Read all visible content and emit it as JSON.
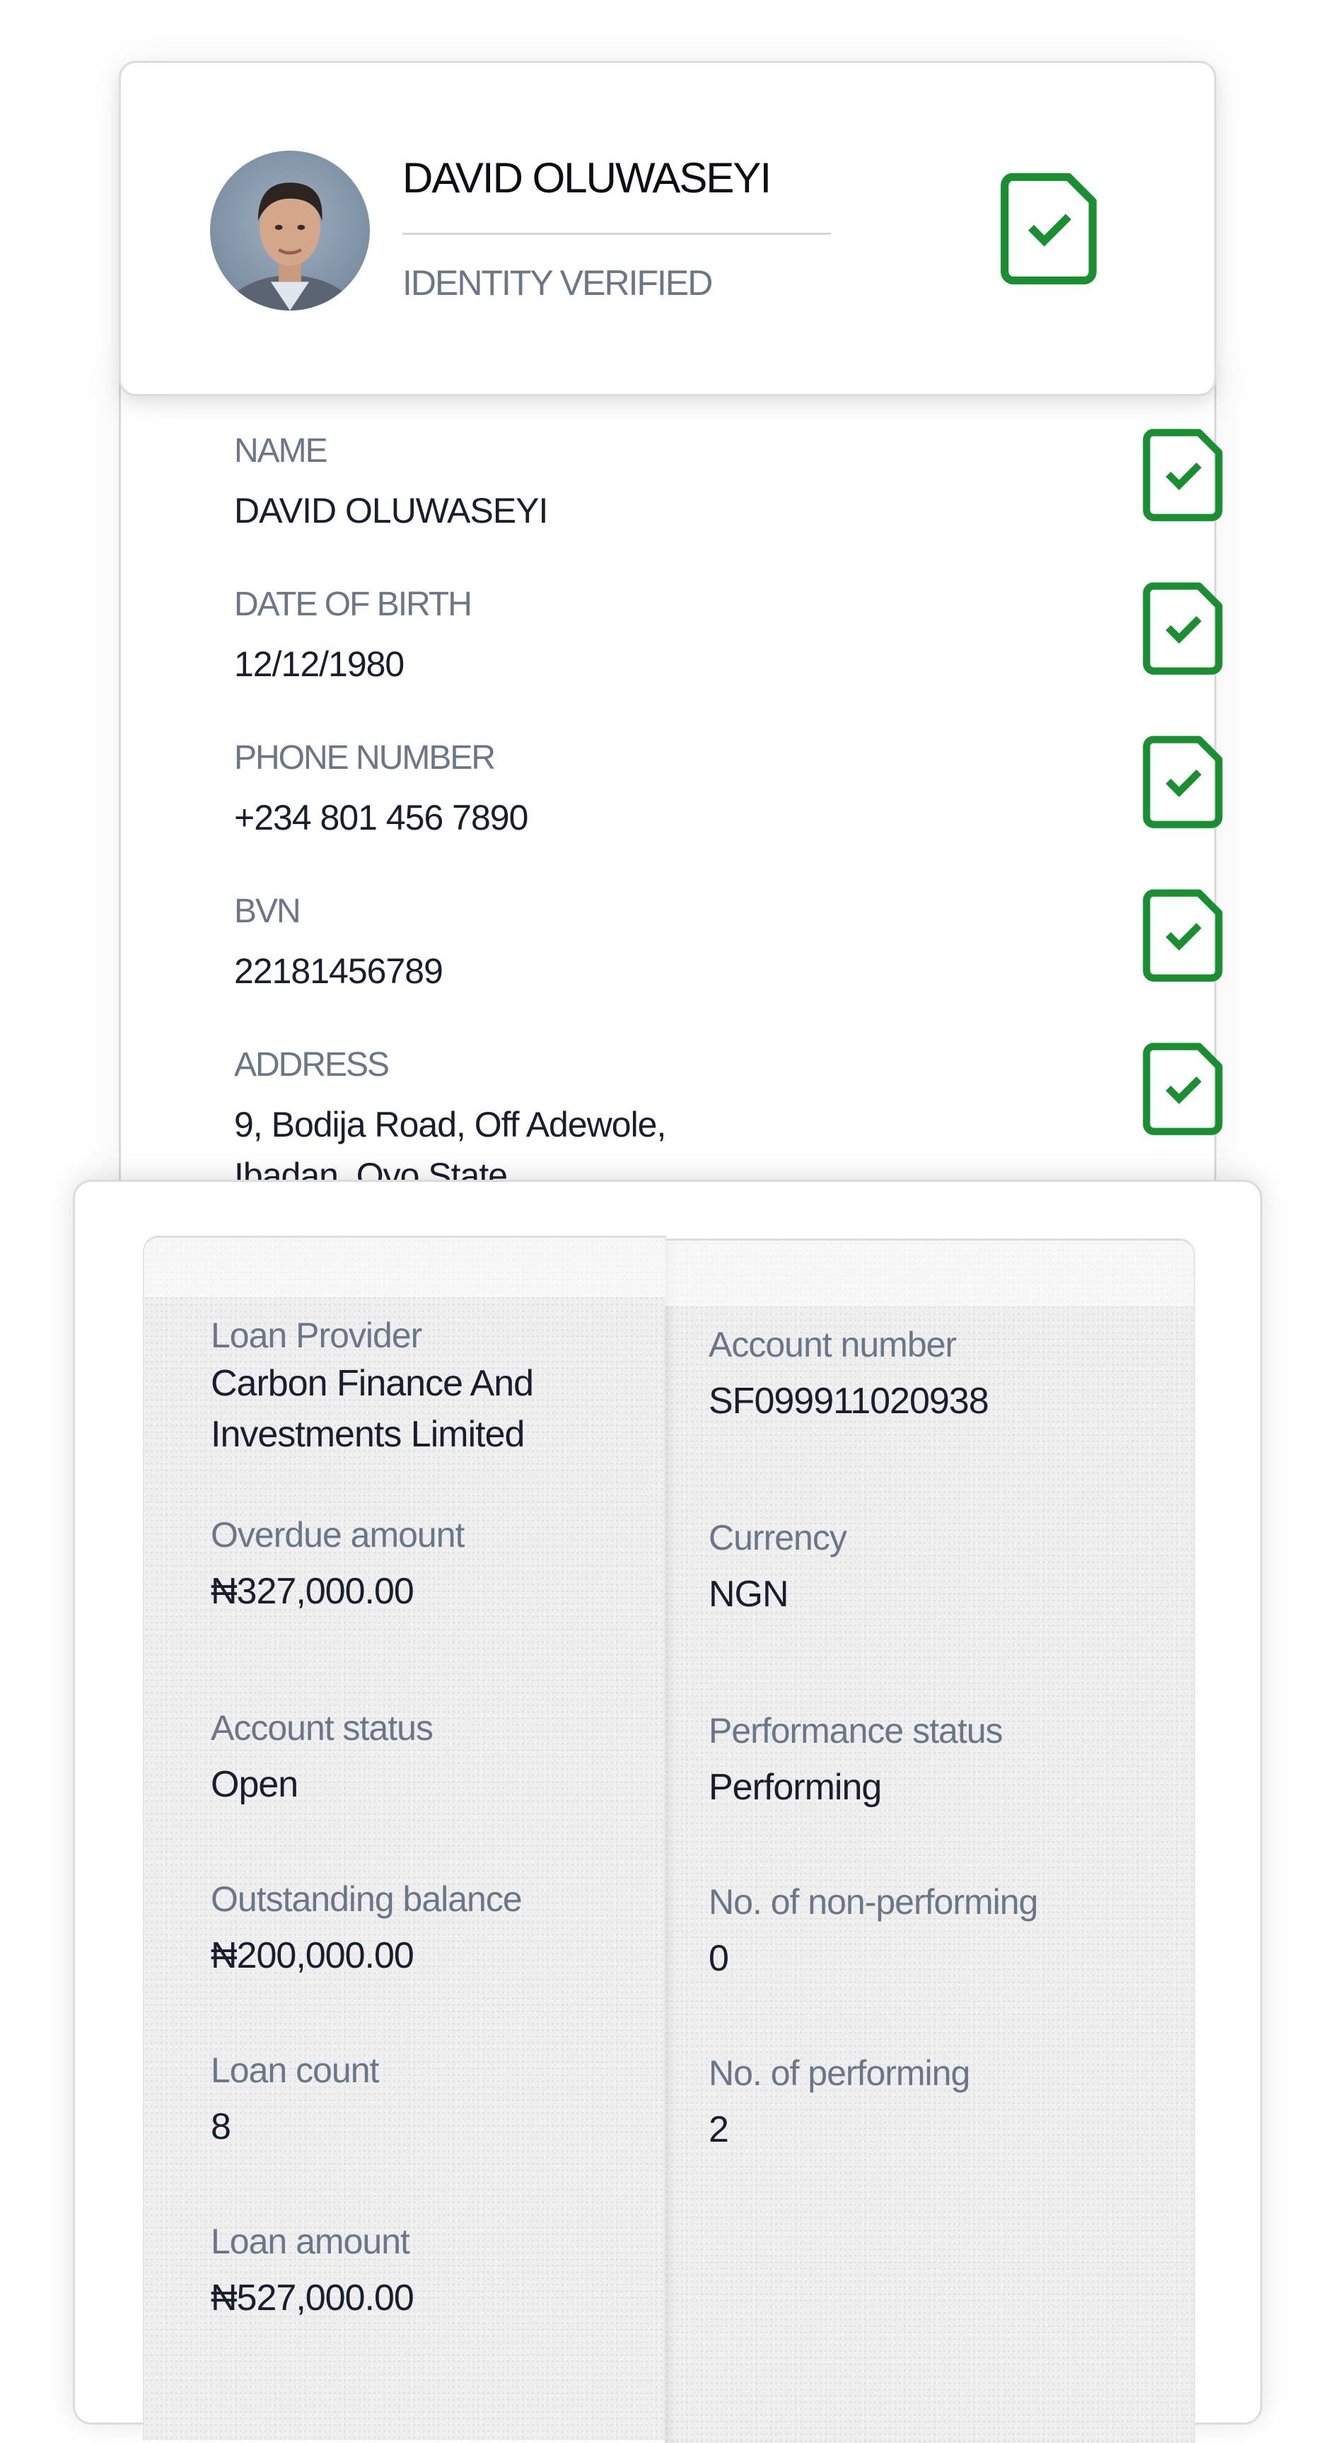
{
  "header": {
    "name": "DAVID OLUWASEYI",
    "status": "IDENTITY VERIFIED",
    "verified_icon": "document-check-icon",
    "accent_color": "#1a8f32"
  },
  "details": [
    {
      "label": "NAME",
      "value": "DAVID OLUWASEYI",
      "verified": true
    },
    {
      "label": "DATE OF BIRTH",
      "value": "12/12/1980",
      "verified": true
    },
    {
      "label": "PHONE NUMBER",
      "value": "+234 801 456 7890",
      "verified": true
    },
    {
      "label": "BVN",
      "value": "22181456789",
      "verified": true
    },
    {
      "label": "ADDRESS",
      "value": "9, Bodija Road, Off Adewole,",
      "value_line2": "Ibadan, Oyo State",
      "verified": true
    }
  ],
  "loan": {
    "left": [
      {
        "label": "Loan Provider",
        "value": "Carbon Finance And",
        "value_line2": "Investments Limited"
      },
      {
        "label": "Overdue amount",
        "value": "₦327,000.00"
      },
      {
        "label": "Account status",
        "value": "Open"
      },
      {
        "label": "Outstanding balance",
        "value": "₦200,000.00"
      },
      {
        "label": "Loan count",
        "value": "8"
      },
      {
        "label": "Loan amount",
        "value": "₦527,000.00"
      }
    ],
    "right": [
      {
        "label": "Account number",
        "value": "SF099911020938"
      },
      {
        "label": "Currency",
        "value": "NGN"
      },
      {
        "label": "Performance status",
        "value": "Performing"
      },
      {
        "label": "No. of non-performing",
        "value": "0"
      },
      {
        "label": "No. of performing",
        "value": "2"
      }
    ]
  }
}
